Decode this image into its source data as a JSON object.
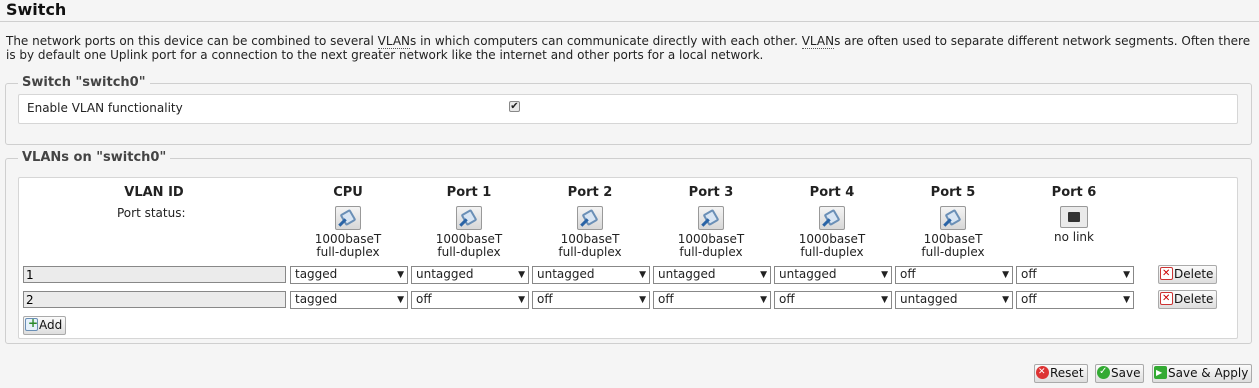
{
  "page": {
    "title": "Switch",
    "description_part1": "The network ports on this device can be combined to several ",
    "vlans_abbr_1": "VLAN",
    "description_part2": "s in which computers can communicate directly with each other. ",
    "vlans_abbr_2": "VLAN",
    "description_part3": "s are often used to separate different network segments. Often there is by default one Uplink port for a connection to the next greater network like the internet and other ports for a local network."
  },
  "switch_section": {
    "legend": "Switch \"switch0\"",
    "enable_vlan_label": "Enable VLAN functionality",
    "enable_vlan_checked": true,
    "check_glyph": "✔"
  },
  "vlans_section": {
    "legend": "VLANs on \"switch0\"",
    "headers": [
      "VLAN ID",
      "CPU",
      "Port 1",
      "Port 2",
      "Port 3",
      "Port 4",
      "Port 5",
      "Port 6"
    ],
    "port_status_label": "Port status:",
    "port_status": [
      {
        "icon": "ethernet-link-icon",
        "speed": "1000baseT",
        "duplex": "full-duplex"
      },
      {
        "icon": "ethernet-link-icon",
        "speed": "1000baseT",
        "duplex": "full-duplex"
      },
      {
        "icon": "ethernet-link-icon",
        "speed": "100baseT",
        "duplex": "full-duplex"
      },
      {
        "icon": "ethernet-link-icon",
        "speed": "1000baseT",
        "duplex": "full-duplex"
      },
      {
        "icon": "ethernet-link-icon",
        "speed": "1000baseT",
        "duplex": "full-duplex"
      },
      {
        "icon": "ethernet-link-icon",
        "speed": "100baseT",
        "duplex": "full-duplex"
      },
      {
        "icon": "ethernet-nolink-icon",
        "speed": "no link",
        "duplex": ""
      }
    ],
    "rows": [
      {
        "vlan_id": "1",
        "ports": [
          "tagged",
          "untagged",
          "untagged",
          "untagged",
          "untagged",
          "off",
          "off"
        ],
        "delete_label": "Delete"
      },
      {
        "vlan_id": "2",
        "ports": [
          "tagged",
          "off",
          "off",
          "off",
          "off",
          "untagged",
          "off"
        ],
        "delete_label": "Delete"
      }
    ],
    "add_label": "Add"
  },
  "footer": {
    "reset_label": "Reset",
    "save_label": "Save",
    "save_apply_label": "Save & Apply"
  },
  "colors": {
    "background": "#f5f5f5",
    "panel": "#ffffff",
    "border": "#cfcfcf"
  }
}
